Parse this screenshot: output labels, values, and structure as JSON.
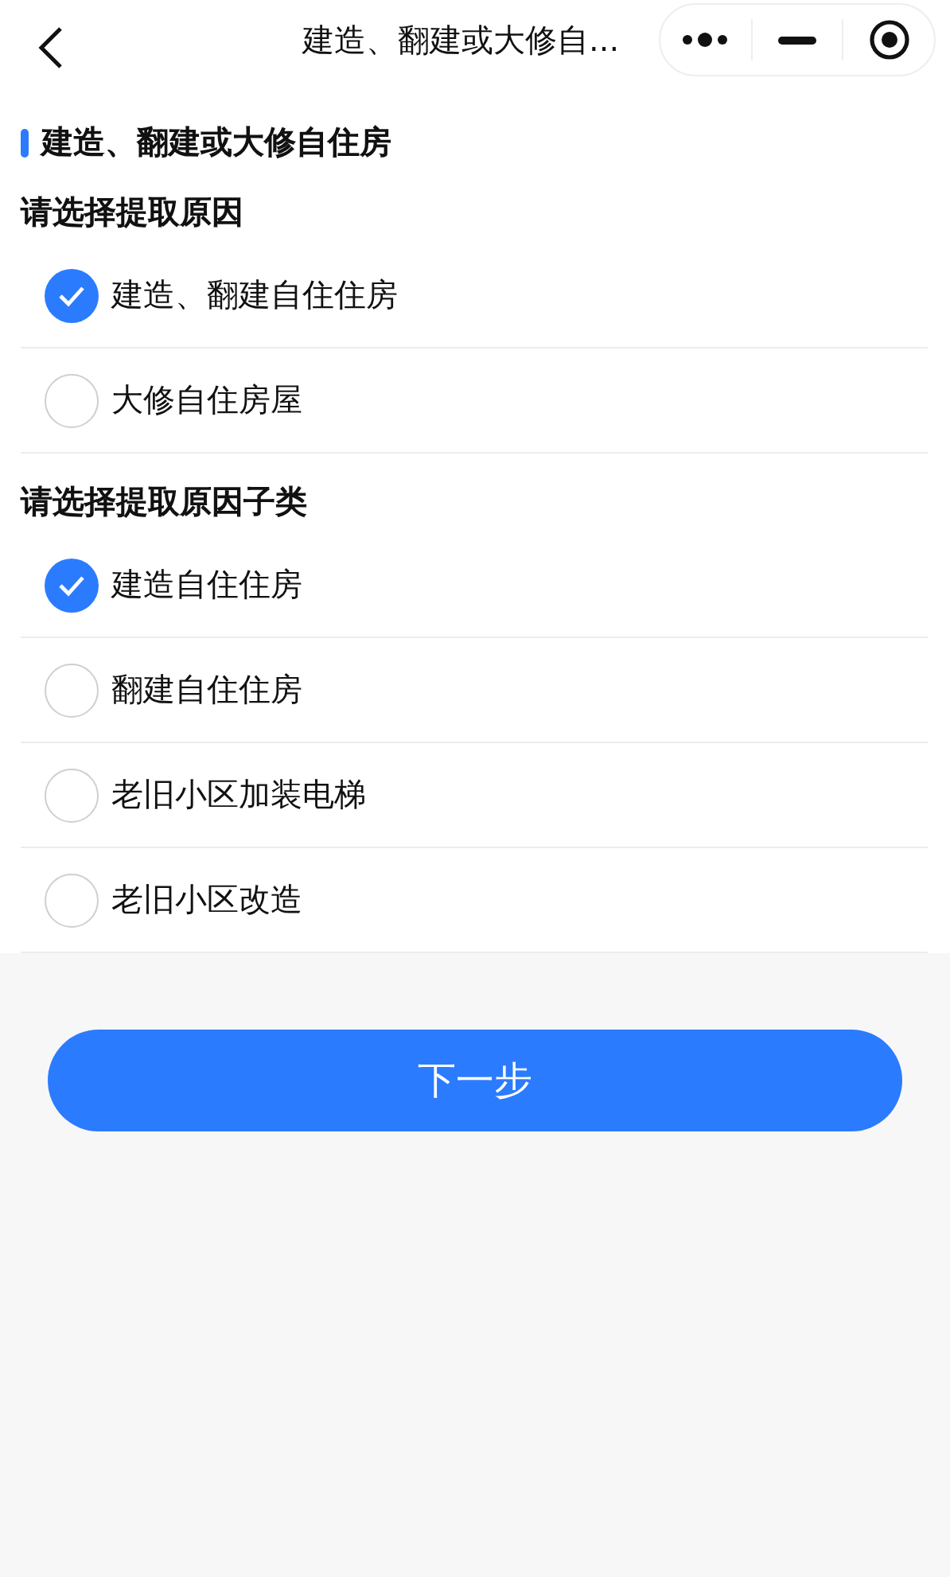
{
  "nav": {
    "title": "建造、翻建或大修自..."
  },
  "section_title": "建造、翻建或大修自住房",
  "groups": [
    {
      "label": "请选择提取原因",
      "options": [
        {
          "label": "建造、翻建自住住房",
          "selected": true
        },
        {
          "label": "大修自住房屋",
          "selected": false
        }
      ]
    },
    {
      "label": "请选择提取原因子类",
      "options": [
        {
          "label": "建造自住住房",
          "selected": true
        },
        {
          "label": "翻建自住住房",
          "selected": false
        },
        {
          "label": "老旧小区加装电梯",
          "selected": false
        },
        {
          "label": "老旧小区改造",
          "selected": false
        }
      ]
    }
  ],
  "next_button": "下一步"
}
